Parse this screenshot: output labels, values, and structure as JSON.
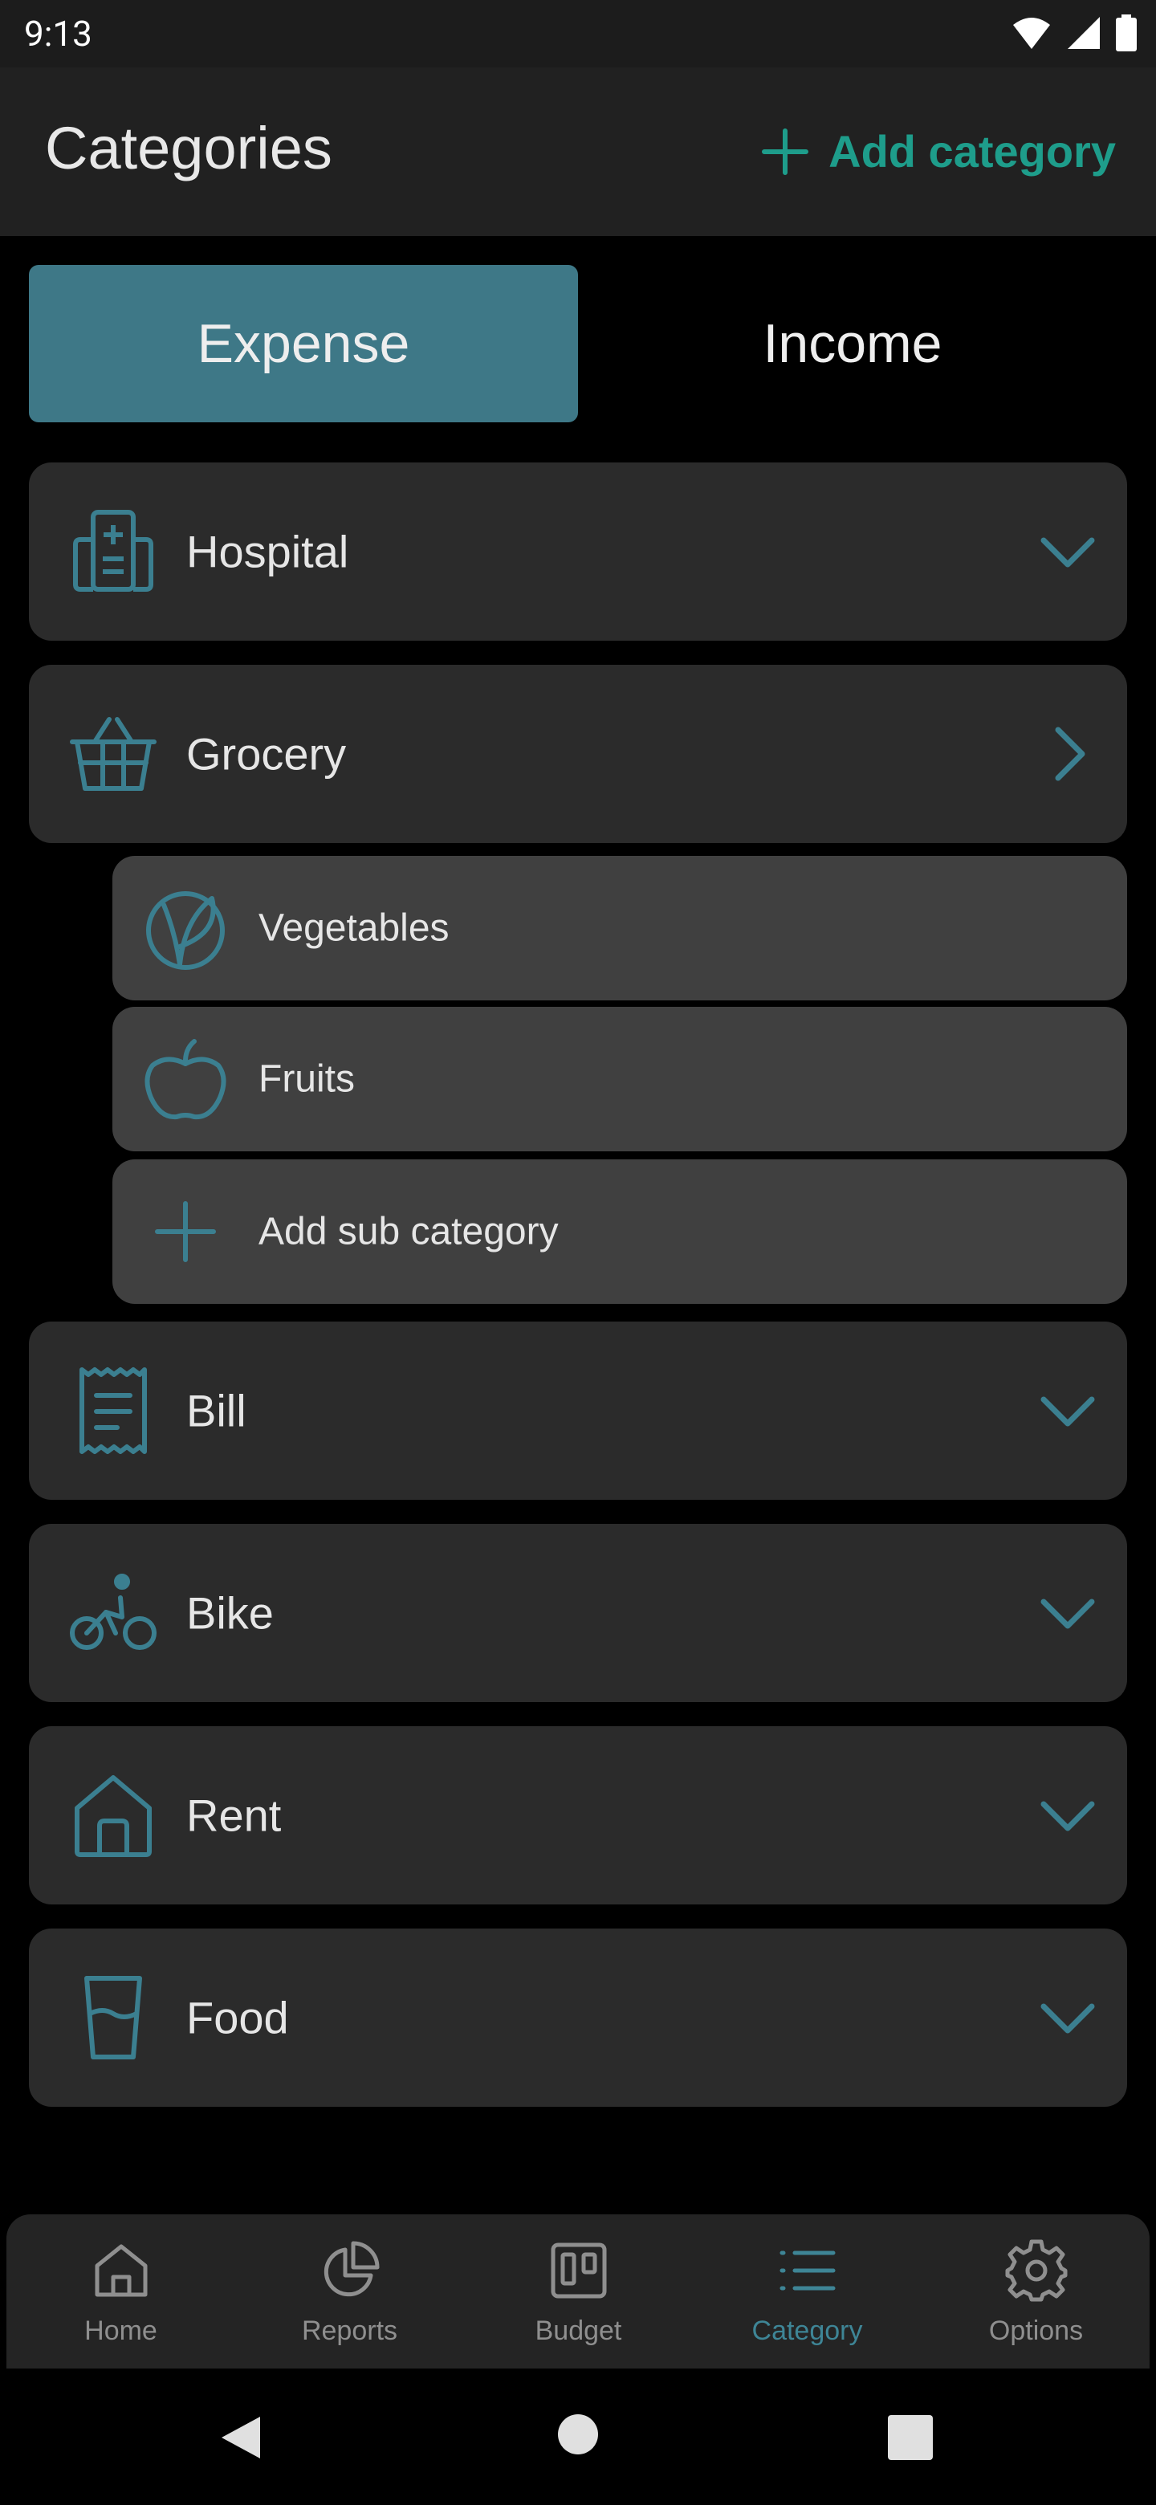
{
  "status_bar": {
    "time": "9:13"
  },
  "app_bar": {
    "title": "Categories",
    "add_label": "Add category"
  },
  "tabs": [
    {
      "label": "Expense"
    },
    {
      "label": "Income"
    }
  ],
  "categories": [
    {
      "label": "Hospital",
      "icon": "hospital-icon",
      "state": "collapsed"
    },
    {
      "label": "Grocery",
      "icon": "basket-icon",
      "state": "expanded",
      "subcategories": [
        {
          "label": "Vegetables",
          "icon": "vegan-leaf-icon"
        },
        {
          "label": "Fruits",
          "icon": "apple-icon"
        },
        {
          "label": "Add sub category",
          "icon": "plus-icon"
        }
      ]
    },
    {
      "label": "Bill",
      "icon": "receipt-icon",
      "state": "collapsed"
    },
    {
      "label": "Bike",
      "icon": "bicycle-icon",
      "state": "collapsed"
    },
    {
      "label": "Rent",
      "icon": "house-icon",
      "state": "collapsed"
    },
    {
      "label": "Food",
      "icon": "glass-icon",
      "state": "collapsed"
    }
  ],
  "bottom_nav": [
    {
      "label": "Home",
      "icon": "home-icon"
    },
    {
      "label": "Reports",
      "icon": "pie-chart-icon"
    },
    {
      "label": "Budget",
      "icon": "kanban-icon"
    },
    {
      "label": "Category",
      "icon": "list-icon",
      "active": true
    },
    {
      "label": "Options",
      "icon": "gear-icon"
    }
  ],
  "colors": {
    "accent": "#3e7887",
    "add_green": "#1e9d8b",
    "icon_teal": "#3b7f90",
    "card": "#2b2b2b",
    "sub_card": "#404040"
  }
}
